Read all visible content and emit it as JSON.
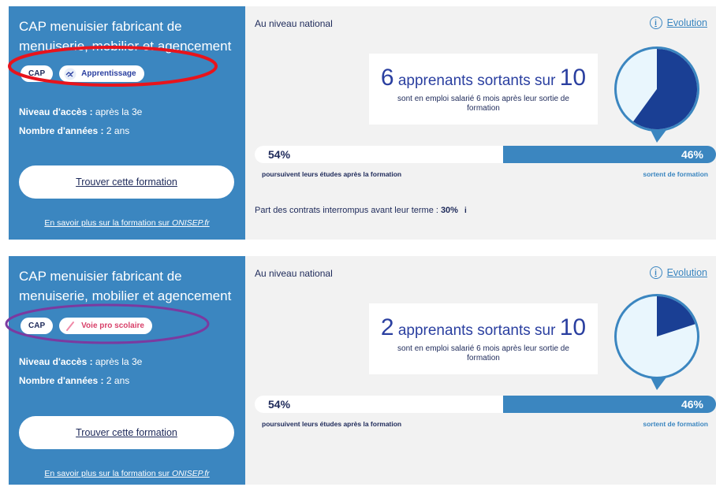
{
  "cards": [
    {
      "title": "CAP menuisier fabricant de menuiserie, mobilier et agencement",
      "badge_cap": "CAP",
      "badge_mode": "Apprentissage",
      "badge_mode_icon": "handshake-icon",
      "niveau_label": "Niveau d'accès :",
      "niveau_value": " après la 3e",
      "annees_label": "Nombre d'années :",
      "annees_value": " 2 ans",
      "find_button": "Trouver cette formation",
      "more_prefix": "En savoir plus sur la formation sur ",
      "more_site": "ONISEP.fr",
      "level": "Au niveau national",
      "evolution": "Evolution",
      "stat_number": "6",
      "stat_text": " apprenants sortants sur ",
      "stat_total": "10",
      "stat_sub": "sont en emploi salarié 6 mois après leur sortie de formation",
      "employed_fraction": 0.6,
      "pie_color": "#1a3f94",
      "bar_left": "54%",
      "bar_right": "46%",
      "bar_left_label": "poursuivent leurs études après la formation",
      "bar_right_label": "sortent de formation",
      "contracts_label": "Part des contrats interrompus avant leur terme :",
      "contracts_value": "30%",
      "contracts_info": "i",
      "highlight_color": "#e8141c"
    },
    {
      "title": "CAP menuisier fabricant de menuiserie, mobilier et agencement",
      "badge_cap": "CAP",
      "badge_mode": "Voie pro scolaire",
      "badge_mode_icon": "pencil-icon",
      "niveau_label": "Niveau d'accès :",
      "niveau_value": " après la 3e",
      "annees_label": "Nombre d'années :",
      "annees_value": " 2 ans",
      "find_button": "Trouver cette formation",
      "more_prefix": "En savoir plus sur la formation sur ",
      "more_site": "ONISEP.fr",
      "level": "Au niveau national",
      "evolution": "Evolution",
      "stat_number": "2",
      "stat_text": " apprenants sortants sur ",
      "stat_total": "10",
      "stat_sub": "sont en emploi salarié 6 mois après leur sortie de formation",
      "employed_fraction": 0.2,
      "pie_color": "#1a3f94",
      "bar_left": "54%",
      "bar_right": "46%",
      "bar_left_label": "poursuivent leurs études après la formation",
      "bar_right_label": "sortent de formation",
      "highlight_color": "#7b3aa0"
    }
  ],
  "colors": {
    "card_blue": "#3b86c0",
    "dark_navy": "#1e2a5a",
    "pie_light": "#e9f6fd"
  }
}
